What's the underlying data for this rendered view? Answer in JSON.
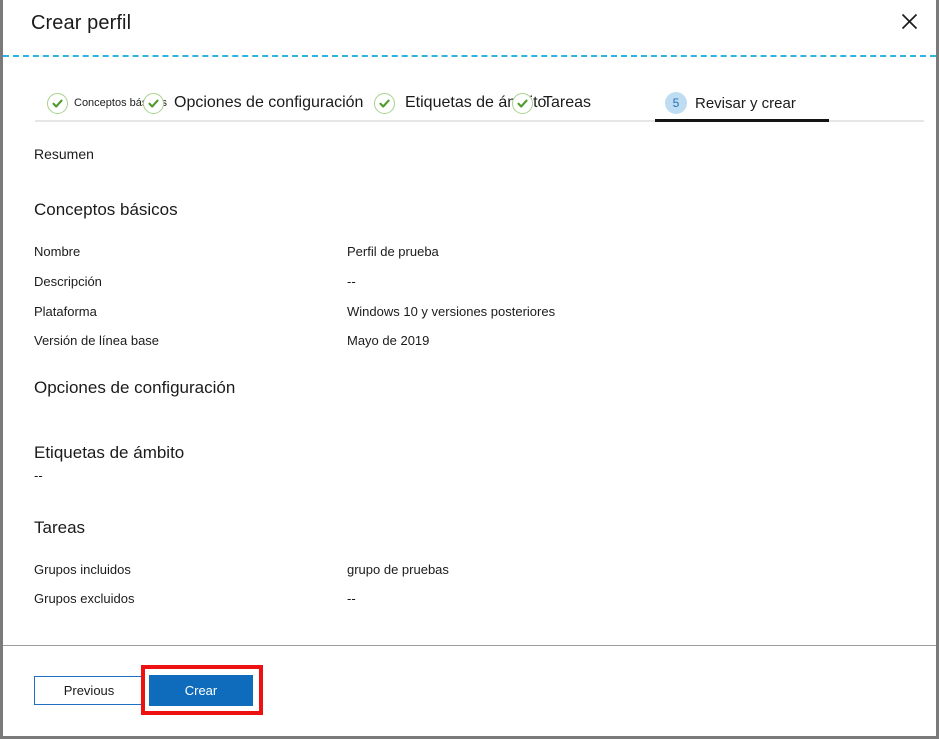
{
  "window": {
    "title": "Crear perfil",
    "close_icon": "close-icon"
  },
  "tabs": [
    {
      "label": "Conceptos básicos",
      "state": "done",
      "icon": "check-circle-icon"
    },
    {
      "label": "Opciones de configuración",
      "state": "done",
      "icon": "check-circle-icon"
    },
    {
      "label": "Etiquetas de ámbito",
      "state": "done",
      "icon": "check-circle-icon"
    },
    {
      "label": "Tareas",
      "state": "done",
      "icon": "check-circle-icon"
    },
    {
      "label": "Revisar y crear",
      "state": "active",
      "badge": "5"
    }
  ],
  "main": {
    "summary_title": "Resumen",
    "sections": [
      {
        "heading": "Conceptos básicos",
        "rows": [
          {
            "label": "Nombre",
            "value": "Perfil de prueba"
          },
          {
            "label": "Descripción",
            "value": "--"
          },
          {
            "label": "Plataforma",
            "value": "Windows 10 y versiones posteriores"
          },
          {
            "label": "Versión de línea base",
            "value": "Mayo de 2019"
          }
        ]
      },
      {
        "heading": "Opciones de configuración",
        "rows": []
      },
      {
        "heading": "Etiquetas de ámbito",
        "plain_value": "--",
        "rows": []
      },
      {
        "heading": "Tareas",
        "rows": [
          {
            "label": "Grupos incluidos",
            "value": "grupo de pruebas"
          },
          {
            "label": "Grupos excluidos",
            "value": "--"
          }
        ]
      }
    ]
  },
  "footer": {
    "previous_label": "Previous",
    "create_label": "Crear"
  },
  "colors": {
    "accent_blue": "#0f6cbd",
    "dashed_rule": "#2fb3e0",
    "check_green": "#4f9a2a",
    "badge_blue": "#bedcf2",
    "annotation_red": "#ee1111",
    "active_underline": "#141414"
  }
}
